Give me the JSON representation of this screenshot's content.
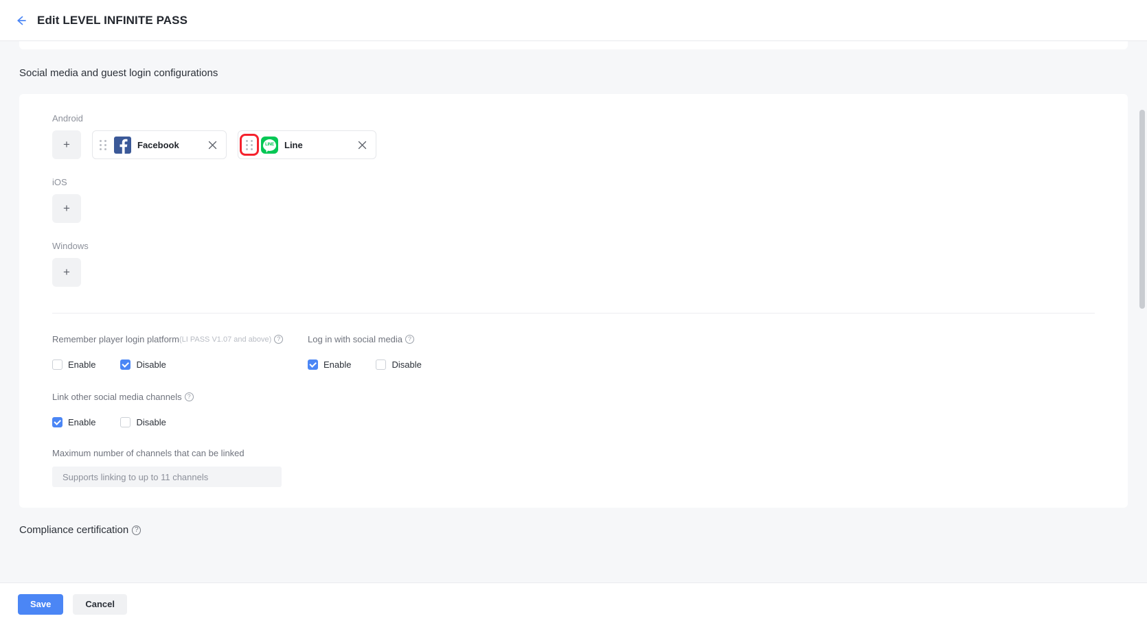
{
  "header": {
    "back_icon": "arrow-left-icon",
    "title": "Edit LEVEL INFINITE PASS"
  },
  "sections": {
    "social": {
      "heading": "Social media and guest login configurations",
      "platforms": [
        {
          "key": "android",
          "label": "Android",
          "add_label": "+",
          "channels": [
            {
              "name": "Facebook",
              "icon": "facebook-icon",
              "handle_highlighted": false,
              "close_label": "×"
            },
            {
              "name": "Line",
              "icon": "line-icon",
              "handle_highlighted": true,
              "close_label": "×"
            }
          ]
        },
        {
          "key": "ios",
          "label": "iOS",
          "add_label": "+",
          "channels": []
        },
        {
          "key": "windows",
          "label": "Windows",
          "add_label": "+",
          "channels": []
        }
      ],
      "options": {
        "remember_login": {
          "title": "Remember player login platform",
          "title_sub": "(LI PASS V1.07 and above)",
          "help": "?",
          "enable_label": "Enable",
          "disable_label": "Disable",
          "enable_checked": false,
          "disable_checked": true
        },
        "social_login": {
          "title": "Log in with social media",
          "help": "?",
          "enable_label": "Enable",
          "disable_label": "Disable",
          "enable_checked": true,
          "disable_checked": false
        },
        "link_channels": {
          "title": "Link other social media channels",
          "help": "?",
          "enable_label": "Enable",
          "disable_label": "Disable",
          "enable_checked": true,
          "disable_checked": false,
          "max_label": "Maximum number of channels that can be linked",
          "max_value": "Supports linking to up to 11 channels"
        }
      }
    },
    "compliance": {
      "heading": "Compliance certification",
      "help": "?"
    }
  },
  "footer": {
    "save_label": "Save",
    "cancel_label": "Cancel"
  },
  "colors": {
    "accent": "#4b86f5",
    "highlight": "#f5222d",
    "facebook": "#3b5998",
    "line": "#06c755"
  }
}
